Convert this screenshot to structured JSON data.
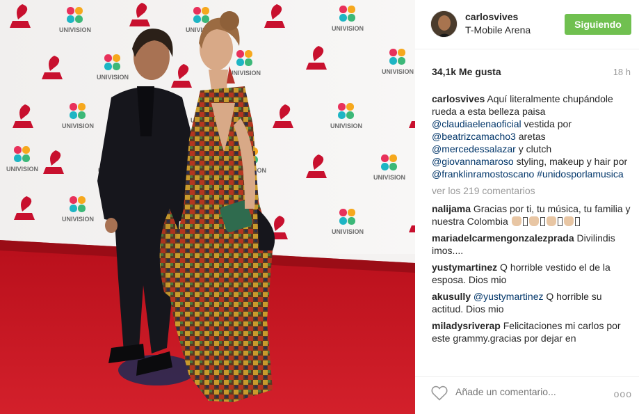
{
  "post": {
    "username": "carlosvives",
    "location": "T-Mobile Arena",
    "follow_label": "Siguiendo",
    "likes": "34,1k Me gusta",
    "time": "18 h"
  },
  "caption": {
    "user": "carlosvives",
    "t1": "Aquí literalmente chupándole rueda a esta belleza paisa",
    "m1": "@claudiaelenaoficial",
    "t2": "vestida por",
    "m2": "@beatrizcamacho3",
    "t3": "aretas",
    "m3": "@mercedessalazar",
    "t4": "y clutch",
    "m4": "@giovannamaroso",
    "t5": "styling, makeup y hair por",
    "m5": "@franklinramostoscano",
    "tag": "#unidosporlamusica"
  },
  "view_all": "ver los 219 comentarios",
  "comments": [
    {
      "user": "nalijama",
      "text": "Gracias por ti, tu música, tu familia y nuestra Colombia"
    },
    {
      "user": "mariadelcarmengonzalezprada",
      "text": "Divilindis imos...."
    },
    {
      "user": "yustymartinez",
      "text": "Q horrible vestido el de la esposa. Dios mio"
    },
    {
      "user": "akusully",
      "mention": "@yustymartinez",
      "text": "Q horrible su actitud. Dios mio"
    },
    {
      "user": "miladysriverap",
      "text": "Felicitaciones mi carlos por este grammy.gracias por dejar en"
    }
  ],
  "footer": {
    "placeholder": "Añade un comentario...",
    "more": "ooo"
  },
  "backdrop": {
    "brand": "UNIVISION"
  },
  "colors": {
    "follow_bg": "#70c050",
    "link": "#003569",
    "carpet": "#c1121e"
  }
}
